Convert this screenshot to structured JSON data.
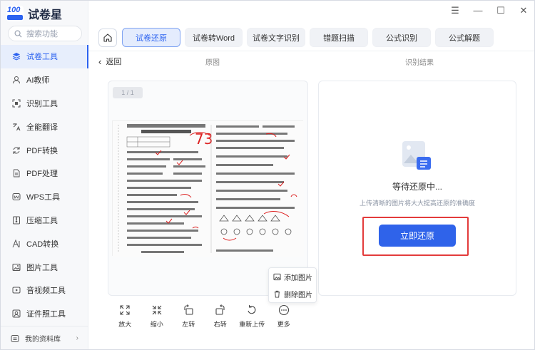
{
  "app": {
    "name": "试卷星",
    "logo_num": "100"
  },
  "search": {
    "placeholder": "搜索功能"
  },
  "sidebar": {
    "items": [
      {
        "label": "试卷工具",
        "icon": "layers-icon"
      },
      {
        "label": "AI教师",
        "icon": "teacher-icon"
      },
      {
        "label": "识别工具",
        "icon": "scan-icon"
      },
      {
        "label": "全能翻译",
        "icon": "translate-icon"
      },
      {
        "label": "PDF转换",
        "icon": "pdf-convert-icon"
      },
      {
        "label": "PDF处理",
        "icon": "pdf-process-icon"
      },
      {
        "label": "WPS工具",
        "icon": "wps-icon"
      },
      {
        "label": "压缩工具",
        "icon": "compress-icon"
      },
      {
        "label": "CAD转换",
        "icon": "cad-icon"
      },
      {
        "label": "图片工具",
        "icon": "image-icon"
      },
      {
        "label": "音视频工具",
        "icon": "media-icon"
      },
      {
        "label": "证件照工具",
        "icon": "id-photo-icon"
      }
    ],
    "bottom": "我的资料库"
  },
  "tabs": [
    {
      "label": "试卷还原"
    },
    {
      "label": "试卷转Word"
    },
    {
      "label": "试卷文字识别"
    },
    {
      "label": "错题扫描"
    },
    {
      "label": "公式识别"
    },
    {
      "label": "公式解题"
    }
  ],
  "subheader": {
    "back": "返回",
    "original": "原图",
    "result": "识别结果"
  },
  "left": {
    "page_indicator": "1 / 1"
  },
  "right": {
    "status": "等待还原中...",
    "hint": "上传清晰的图片将大大提高还原的准确度",
    "button": "立即还原"
  },
  "popup": {
    "add": "添加图片",
    "delete": "删除图片"
  },
  "toolbar": [
    {
      "label": "放大"
    },
    {
      "label": "缩小"
    },
    {
      "label": "左转"
    },
    {
      "label": "右转"
    },
    {
      "label": "重新上传"
    },
    {
      "label": "更多"
    }
  ],
  "colors": {
    "accent": "#2f63ea",
    "highlight": "#e33b3b"
  }
}
